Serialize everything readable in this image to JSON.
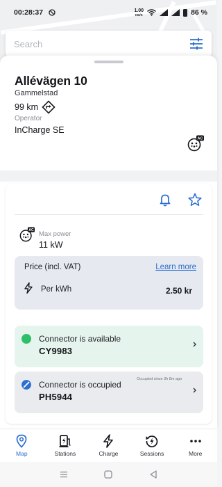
{
  "status_bar": {
    "time": "00:28:37",
    "net_speed_value": "1.00",
    "net_speed_unit": "KB/S",
    "battery": "86 %"
  },
  "search": {
    "placeholder": "Search",
    "filter_icon": "sliders-icon"
  },
  "station": {
    "name": "Allévägen 10",
    "area": "Gammelstad",
    "distance": "99 km",
    "operator_label": "Operator",
    "operator": "InCharge SE",
    "connector_type_badge": "AC"
  },
  "details": {
    "max_power_label": "Max power",
    "max_power_value": "11 kW",
    "power_badge": "AC",
    "price": {
      "title": "Price (incl. VAT)",
      "learn_more": "Learn more",
      "per_kwh_label": "Per kWh",
      "per_kwh_value": "2.50 kr"
    },
    "connectors": [
      {
        "status": "Connector is available",
        "id": "CY9983",
        "status_color": "#2fbf6a"
      },
      {
        "status": "Connector is occupied",
        "id": "PH5944",
        "occupied_since": "Occupied since 3h 8m ago",
        "status_color": "#2b6fd0"
      }
    ]
  },
  "bottom_nav": {
    "items": [
      {
        "label": "Map",
        "icon": "location-pin-icon",
        "active": true
      },
      {
        "label": "Stations",
        "icon": "charging-station-icon",
        "active": false
      },
      {
        "label": "Charge",
        "icon": "bolt-icon",
        "active": false
      },
      {
        "label": "Sessions",
        "icon": "history-bolt-icon",
        "active": false
      },
      {
        "label": "More",
        "icon": "more-dots-icon",
        "active": false
      }
    ]
  },
  "colors": {
    "accent": "#2b6fd0",
    "available_bg": "#e5f4ec",
    "price_box_bg": "#e6e9ef"
  }
}
